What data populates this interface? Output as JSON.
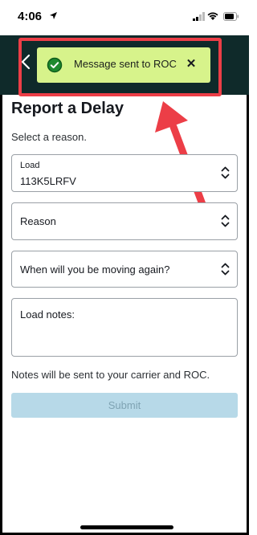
{
  "status_bar": {
    "time": "4:06"
  },
  "toast": {
    "message": "Message sent to ROC",
    "close_label": "✕"
  },
  "form": {
    "title": "Report a Delay",
    "subtitle": "Select a reason.",
    "load_field": {
      "label": "Load",
      "value": "113K5LRFV"
    },
    "reason_field": {
      "label": "Reason"
    },
    "moving_field": {
      "label": "When will you be moving again?"
    },
    "notes_field": {
      "label": "Load notes:"
    },
    "helper_text": "Notes will be sent to your carrier and ROC.",
    "submit_label": "Submit"
  },
  "colors": {
    "header_bg": "#0f2a2a",
    "toast_bg": "#d7f38b",
    "annotation_red": "#ec3e47",
    "submit_disabled_bg": "#b7d9e8"
  },
  "icons": [
    "location-arrow-icon",
    "signal-icon",
    "wifi-icon",
    "battery-icon",
    "back-chevron-icon",
    "check-circle-icon",
    "close-icon",
    "select-chevrons-icon"
  ]
}
